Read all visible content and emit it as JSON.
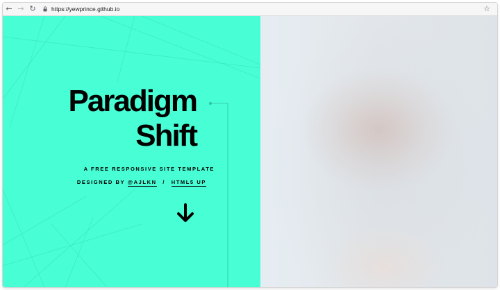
{
  "browser": {
    "url": "https://yewprince.github.io",
    "back_icon": "arrow-left-icon",
    "forward_icon": "arrow-right-icon",
    "reload_icon": "reload-icon",
    "lock_icon": "lock-icon",
    "bookmark_icon": "star-icon"
  },
  "hero": {
    "title_line1": "Paradigm",
    "title_line2": "Shift",
    "tagline": "A free responsive site template",
    "credits_prefix": "Designed by",
    "credit_link1": "@ajlkn",
    "credit_separator": "/",
    "credit_link2": "HTML5 UP",
    "scroll_icon": "arrow-down-icon"
  },
  "colors": {
    "accent": "#48fed5",
    "text": "#000000"
  }
}
